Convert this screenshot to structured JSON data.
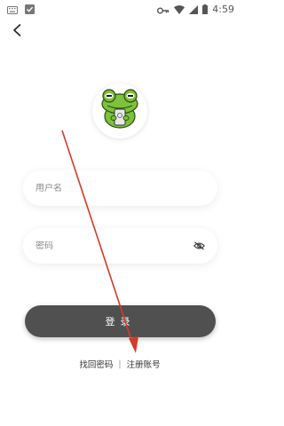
{
  "status_bar": {
    "time": "4:59",
    "left_icons": [
      "keyboard-icon",
      "shield-check-icon"
    ],
    "right_icons": [
      "key-icon",
      "wifi-icon",
      "signal-icon",
      "battery-icon"
    ]
  },
  "nav": {
    "back_icon": "chevron-left-icon"
  },
  "logo": {
    "description": "frog-mascot-icon"
  },
  "form": {
    "username_placeholder": "用户名",
    "password_placeholder": "密码",
    "password_toggle_icon": "eye-off-icon"
  },
  "login_button": {
    "label": "登录"
  },
  "links": {
    "forgot_password": "找回密码",
    "separator": "|",
    "register": "注册账号"
  },
  "colors": {
    "button_bg": "#505050",
    "annotation_arrow": "#d63a2a",
    "frog_green": "#7cc23a"
  }
}
